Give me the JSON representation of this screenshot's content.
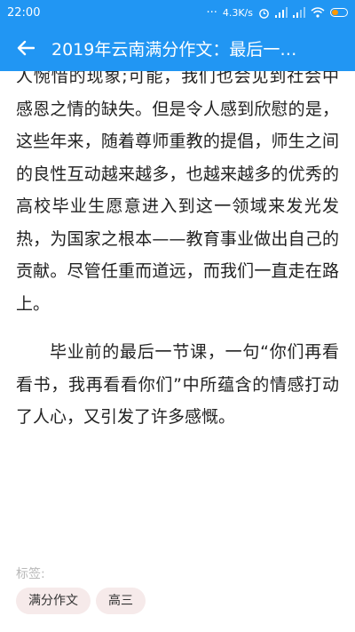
{
  "status_bar": {
    "time": "22:00",
    "dots": "···",
    "net_speed": "4.3K/s",
    "alarm_icon": "alarm-icon",
    "signal_icon": "signal-icon",
    "wifi_icon": "wifi-icon",
    "battery_icon": "battery-icon",
    "battery_level": 0.4
  },
  "app_bar": {
    "title": "2019年云南满分作文：最后一…",
    "back_icon": "back-arrow-icon"
  },
  "article": {
    "paragraph_1": "人惋惜的现象;可能，我们也会见到社会中感恩之情的缺失。但是令人感到欣慰的是，这些年来，随着尊师重教的提倡，师生之间的良性互动越来越多，也越来越多的优秀的高校毕业生愿意进入到这一领域来发光发热，为国家之根本——教育事业做出自己的贡献。尽管任重而道远，而我们一直走在路上。",
    "paragraph_2": "毕业前的最后一节课，一句“你们再看看书，我再看看你们”中所蕴含的情感打动了人心，又引发了许多感慨。"
  },
  "tags": {
    "label": "标签:",
    "items": [
      "满分作文",
      "高三"
    ]
  },
  "colors": {
    "primary": "#2196f3",
    "tag_bg": "#f6eaea",
    "battery": "#ff9800"
  }
}
